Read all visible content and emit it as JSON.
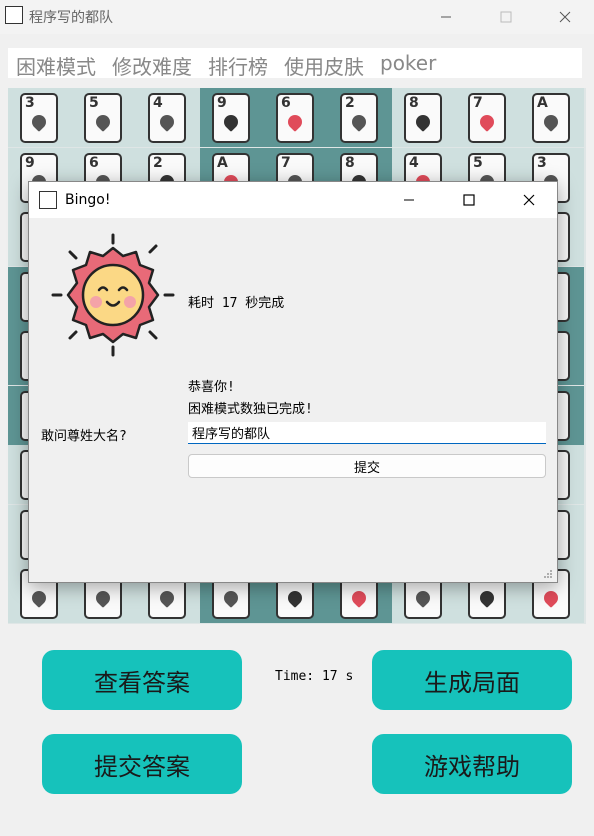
{
  "window": {
    "title": "程序写的都队"
  },
  "menu": {
    "items": [
      "困难模式",
      "修改难度",
      "排行榜",
      "使用皮肤",
      "poker"
    ]
  },
  "board": {
    "visible_ranks": [
      [
        "3",
        "5",
        "4",
        "9",
        "6",
        "2",
        "8",
        "7",
        "A"
      ],
      [
        "9",
        "6",
        "2",
        "A",
        "7",
        "8",
        "4",
        "5",
        "3"
      ]
    ]
  },
  "bottom": {
    "view_answer": "查看答案",
    "generate": "生成局面",
    "submit_answer": "提交答案",
    "help": "游戏帮助",
    "timer": "Time: 17 s"
  },
  "dialog": {
    "title": "Bingo!",
    "elapsed": "耗时 17 秒完成",
    "congrats_line1": "恭喜你!",
    "congrats_line2": "困难模式数独已完成!",
    "name_label": "敢问尊姓大名?",
    "name_value": "程序写的都队",
    "submit": "提交"
  },
  "colors": {
    "accent_button": "#16c2bb",
    "board_dark": "#5e9594",
    "board_light": "#cfe0df",
    "sun_outer": "#e86a78",
    "sun_face": "#fbd885"
  }
}
